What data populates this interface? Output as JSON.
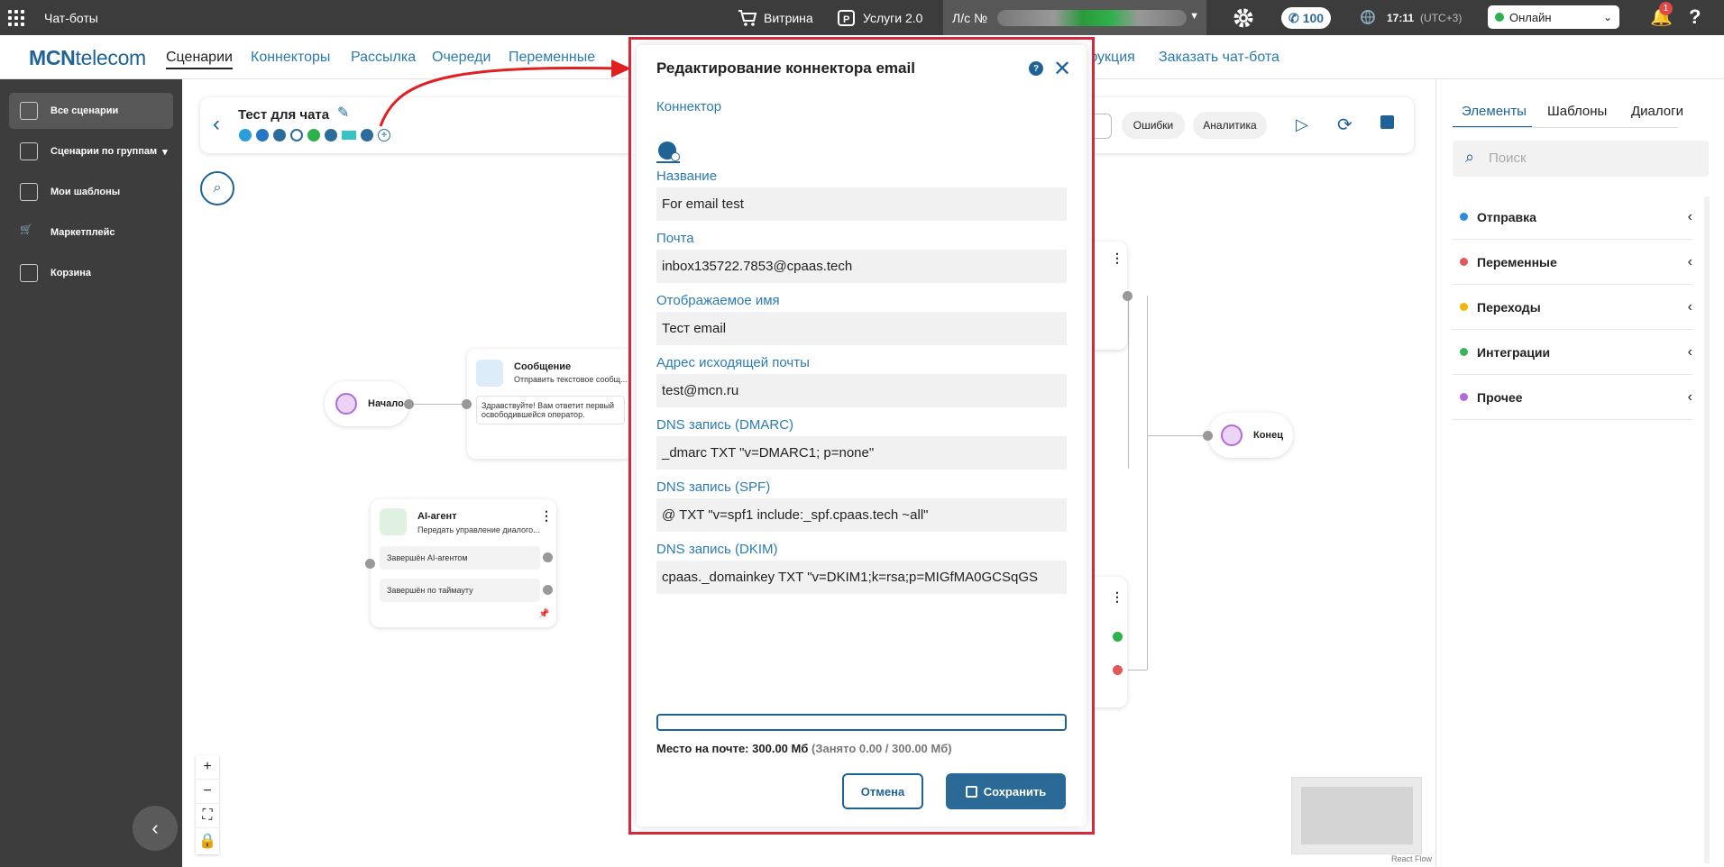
{
  "topbar": {
    "app_name": "Чат-боты",
    "showcase": "Витрина",
    "services": "Услуги 2.0",
    "account_prefix": "Л/с №",
    "calls_count": "100",
    "time": "17:11",
    "timezone": "(UTC+3)",
    "status": "Онлайн",
    "notifications": "1"
  },
  "navbar": {
    "logo_bold": "MCN",
    "logo_rest": "telecom",
    "items": [
      "Сценарии",
      "Коннекторы",
      "Рассылка",
      "Очереди",
      "Переменные",
      "трукция",
      "Заказать чат-бота"
    ]
  },
  "sidebar": {
    "items": [
      "Все сценарии",
      "Сценарии по группам",
      "Мои шаблоны",
      "Маркетплейс",
      "Корзина"
    ]
  },
  "canvas": {
    "scenario_title": "Тест для чата",
    "errors_label": "Ошибки",
    "analytics_label": "Аналитика",
    "nodes": {
      "start": "Начало",
      "message_title": "Сообщение",
      "message_sub": "Отправить текстовое сообщ...",
      "message_body": "Здравствуйте! Вам ответит первый освободившейся оператор.",
      "ai_title": "AI-агент",
      "ai_sub": "Передать управление диалого...",
      "ai_opt1": "Завершён AI-агентом",
      "ai_opt2": "Завершён по таймауту",
      "end": "Конец"
    },
    "react_flow": "React Flow"
  },
  "right_panel": {
    "tabs": [
      "Элементы",
      "Шаблоны",
      "Диалоги"
    ],
    "search_placeholder": "Поиск",
    "categories": [
      {
        "label": "Отправка",
        "color": "#2f8ad8"
      },
      {
        "label": "Переменные",
        "color": "#e05a5a"
      },
      {
        "label": "Переходы",
        "color": "#f2b705"
      },
      {
        "label": "Интеграции",
        "color": "#3bb35a"
      },
      {
        "label": "Прочее",
        "color": "#b36ad9"
      }
    ]
  },
  "modal": {
    "title": "Редактирование коннектора email",
    "connector_label": "Коннектор",
    "fields": [
      {
        "label": "Название",
        "value": "For email test"
      },
      {
        "label": "Почта",
        "value": "inbox135722.7853@cpaas.tech"
      },
      {
        "label": "Отображаемое имя",
        "value": "Тест email"
      },
      {
        "label": "Адрес исходящей почты",
        "value": "test@mcn.ru"
      },
      {
        "label": "DNS запись (DMARC)",
        "value": "_dmarc TXT \"v=DMARC1; p=none\""
      },
      {
        "label": "DNS запись (SPF)",
        "value": "@ TXT \"v=spf1 include:_spf.cpaas.tech ~all\""
      },
      {
        "label": "DNS запись (DKIM)",
        "value": "cpaas._domainkey TXT \"v=DKIM1;k=rsa;p=MIGfMA0GCSqGS"
      }
    ],
    "quota_label": "Место на почте:",
    "quota_value": "300.00 Мб",
    "quota_detail": "(Занято 0.00 / 300.00 Мб)",
    "quota_used_fraction": 0,
    "cancel_label": "Отмена",
    "save_label": "Сохранить"
  }
}
